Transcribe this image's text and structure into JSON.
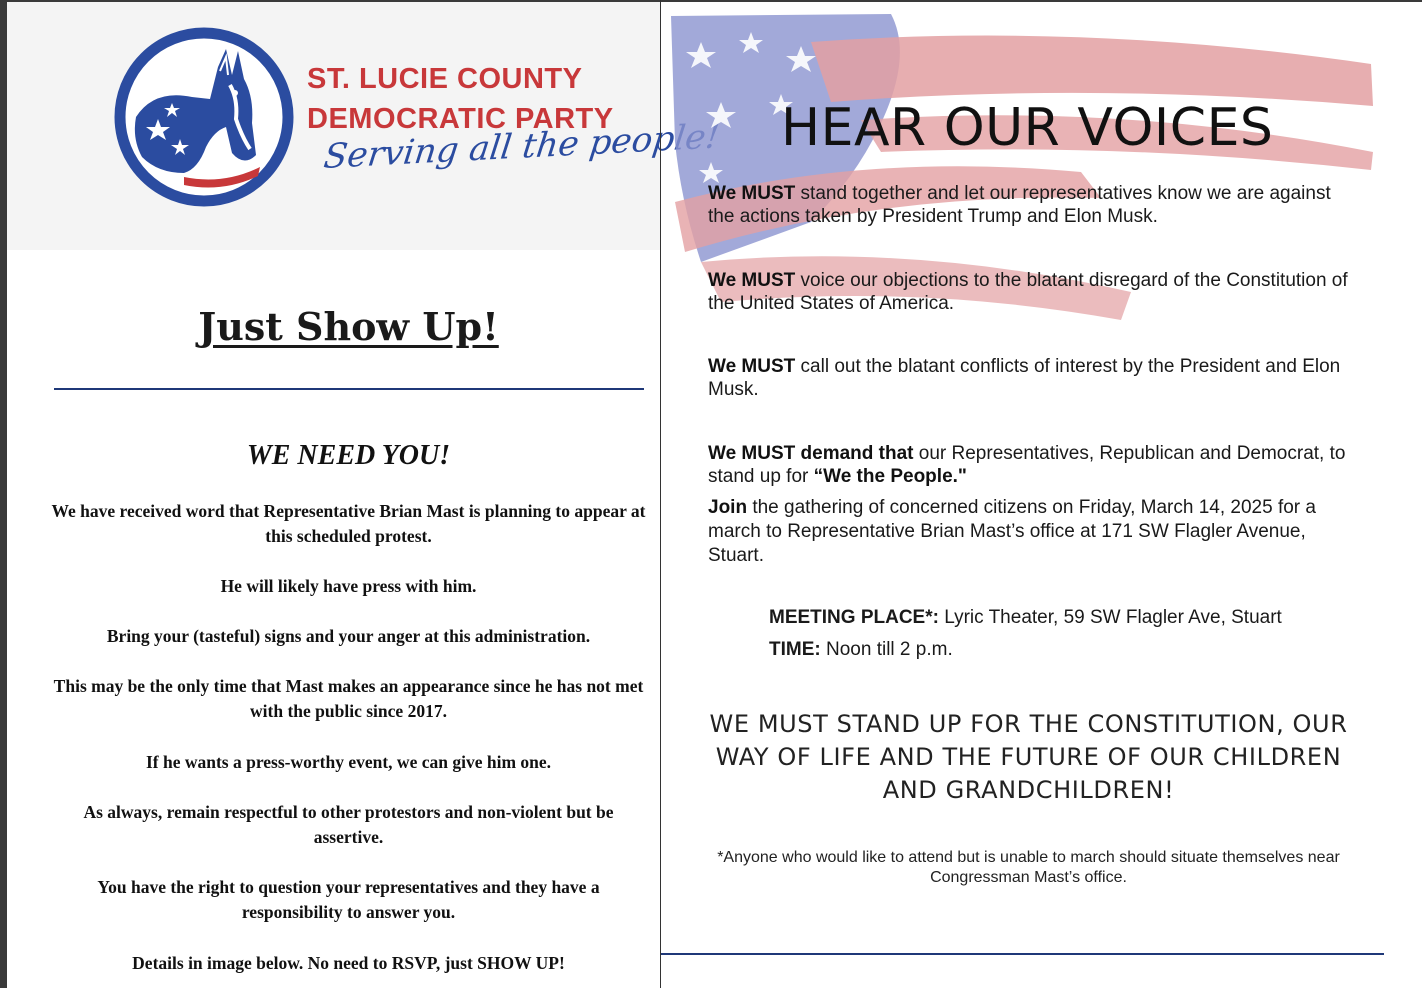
{
  "left": {
    "logo": {
      "line1": "ST. LUCIE COUNTY",
      "line2": "DEMOCRATIC PARTY",
      "tagline": "Serving all the people!",
      "icon": "donkey-logo-icon",
      "colors": {
        "red": "#c8383a",
        "blue": "#2b4ca0"
      }
    },
    "headline": "Just Show Up!",
    "subhead": "WE NEED YOU!",
    "paragraphs": [
      "We have received word that Representative Brian Mast is planning to appear at this scheduled protest.",
      "He will likely have press with him.",
      "Bring your (tasteful) signs and your anger at this administration.",
      "This may be the only time that Mast makes an appearance since he has not met with the public since 2017.",
      "If he wants a press-worthy event, we can give him one.",
      "As always, remain respectful to other protestors and non-violent but be assertive.",
      "You have the right to question your representatives and they have a responsibility to answer you.",
      "Details in image below. No need to RSVP, just SHOW UP!"
    ]
  },
  "right": {
    "title": "HEAR OUR VOICES",
    "items": [
      {
        "bold": "We MUST",
        "text": " stand together and let our representatives know we are against the actions taken by President Trump and Elon Musk."
      },
      {
        "bold": "We MUST",
        "text": " voice our objections to the blatant disregard of the Constitution of the United States of America."
      },
      {
        "bold": "We MUST",
        "text": " call out the blatant conflicts of interest by the President and Elon Musk."
      },
      {
        "bold": "We MUST demand that",
        "text": " our Representatives, Republican and Democrat, to stand up for ",
        "bold2": "“We the People.\""
      },
      {
        "bold": "Join",
        "text": " the gathering of concerned citizens on Friday, March 14, 2025 for a march to Representative Brian Mast’s office at 171 SW Flagler Avenue, Stuart."
      }
    ],
    "meeting": {
      "label": "MEETING PLACE*:",
      "value": " Lyric Theater, 59 SW Flagler Ave, Stuart"
    },
    "time": {
      "label": "TIME:",
      "value": " Noon till 2 p.m."
    },
    "big_message": "WE MUST STAND UP FOR THE CONSTITUTION, OUR WAY OF LIFE AND THE FUTURE OF OUR CHILDREN AND GRANDCHILDREN!",
    "footnote": "*Anyone who would like to attend but is unable to march should situate themselves near Congressman Mast’s office.",
    "flag_icon": "american-flag-brushstroke-icon"
  }
}
